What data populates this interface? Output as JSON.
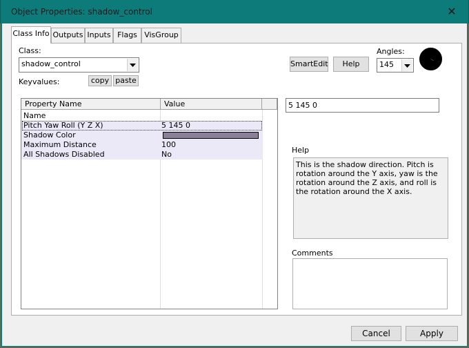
{
  "window": {
    "title": "Object Properties: shadow_control",
    "close_glyph": "✕"
  },
  "tabs": [
    {
      "label": "Class Info",
      "active": true
    },
    {
      "label": "Outputs"
    },
    {
      "label": "Inputs"
    },
    {
      "label": "Flags"
    },
    {
      "label": "VisGroup"
    }
  ],
  "class_section": {
    "class_label": "Class:",
    "class_value": "shadow_control",
    "keyvalues_label": "Keyvalues:",
    "copy_label": "copy",
    "paste_label": "paste"
  },
  "toolbar": {
    "smartedit_label": "SmartEdit",
    "help_label": "Help",
    "angles_label": "Angles:",
    "angles_value": "145"
  },
  "grid": {
    "headers": [
      "Property Name",
      "Value"
    ],
    "rows": [
      {
        "name": "Name",
        "value": ""
      },
      {
        "name": "Pitch Yaw Roll (Y Z X)",
        "value": "5 145 0"
      },
      {
        "name": "Shadow Color",
        "value": "",
        "swatch": "#8a8198"
      },
      {
        "name": "Maximum Distance",
        "value": "100"
      },
      {
        "name": "All Shadows Disabled",
        "value": "No"
      }
    ]
  },
  "value_edit": "5 145 0",
  "help": {
    "label": "Help",
    "text": "This is the shadow direction. Pitch is rotation around the Y axis, yaw is the rotation around the Z axis, and roll is the rotation around the X axis."
  },
  "comments": {
    "label": "Comments",
    "value": ""
  },
  "footer": {
    "cancel_label": "Cancel",
    "apply_label": "Apply"
  },
  "colors": {
    "titlebar": "#0e7b7b",
    "row_highlight": "#ebe8f8"
  }
}
